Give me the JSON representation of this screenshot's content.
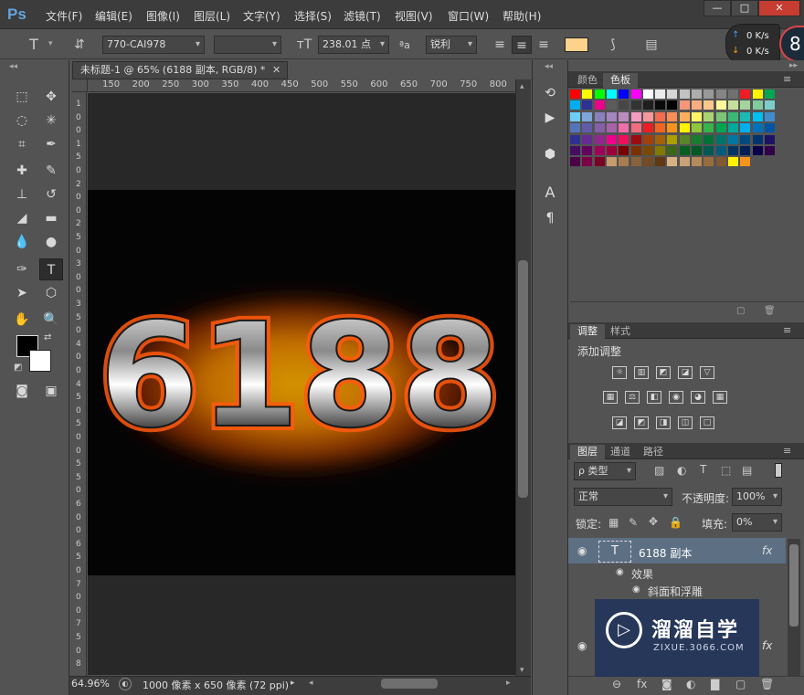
{
  "app": {
    "logo": "Ps"
  },
  "menu": [
    "文件(F)",
    "编辑(E)",
    "图像(I)",
    "图层(L)",
    "文字(Y)",
    "选择(S)",
    "滤镜(T)",
    "视图(V)",
    "窗口(W)",
    "帮助(H)"
  ],
  "window_buttons": {
    "minimize": "—",
    "restore": "□",
    "close": "✕"
  },
  "options": {
    "font_family": "770-CAI978",
    "font_style": "",
    "font_size": "238.01 点",
    "aa_label": "ªa",
    "antialias": "锐利",
    "swatch_color": "#fcd28c"
  },
  "network": {
    "up": "0 K/s",
    "down": "0 K/s",
    "number": "8"
  },
  "document": {
    "tab_title": "未标题-1 @ 65% (6188 副本, RGB/8) *",
    "zoom": "64.96%",
    "doc_info": "1000 像素 x 650 像素 (72 ppi)",
    "text_content": "6188"
  },
  "ruler": {
    "h_labels": [
      "150",
      "200",
      "250",
      "300",
      "350",
      "400",
      "450",
      "500",
      "550",
      "600",
      "650",
      "700",
      "750",
      "800"
    ],
    "v_labels": [
      "1",
      "0",
      "0",
      "1",
      "5",
      "0",
      "2",
      "0",
      "0",
      "2",
      "5",
      "0",
      "3",
      "0",
      "0",
      "3",
      "5",
      "0",
      "4",
      "0",
      "0",
      "4",
      "5",
      "0",
      "5",
      "0",
      "0",
      "5",
      "5",
      "0",
      "6",
      "0",
      "0",
      "6",
      "5",
      "0",
      "7",
      "0",
      "0",
      "7",
      "5",
      "0",
      "8"
    ]
  },
  "swatches_panel": {
    "tabs": [
      "颜色",
      "色板"
    ],
    "active": "色板",
    "colors": [
      "#ff0000",
      "#ffff00",
      "#00ff00",
      "#00ffff",
      "#0000ff",
      "#ff00ff",
      "#ffffff",
      "#ebebeb",
      "#d6d6d6",
      "#c2c2c2",
      "#adadad",
      "#999999",
      "#858585",
      "#707070",
      "#ee1d24",
      "#fff200",
      "#00a651",
      "#00aeef",
      "#2e3192",
      "#ec008c",
      "#5c5c5c",
      "#474747",
      "#333333",
      "#1f1f1f",
      "#0a0a0a",
      "#000000",
      "#f7977a",
      "#fbad82",
      "#fdc68c",
      "#fff799",
      "#c6df9c",
      "#a4d49d",
      "#81ca9d",
      "#7bcdc8",
      "#6ccff7",
      "#7da7d9",
      "#8781bd",
      "#a286bd",
      "#bc8cbf",
      "#f49bc1",
      "#f5989d",
      "#f26c4f",
      "#f68e56",
      "#fbaf5d",
      "#fff467",
      "#acd372",
      "#7cc576",
      "#3bb878",
      "#1abbb4",
      "#00bff3",
      "#438ccb",
      "#5574b9",
      "#605ca8",
      "#855fa8",
      "#a763a9",
      "#ef6ea8",
      "#f16d7e",
      "#ee1d24",
      "#f16522",
      "#f7941d",
      "#fff200",
      "#8fc63d",
      "#37b44a",
      "#00a650",
      "#00a99e",
      "#00aeef",
      "#0072bc",
      "#0054a5",
      "#2f3192",
      "#652c91",
      "#91278f",
      "#ed008c",
      "#ee105a",
      "#9d0a0f",
      "#a1410d",
      "#a36209",
      "#aba000",
      "#588528",
      "#197b30",
      "#007236",
      "#00736a",
      "#0076a4",
      "#004a80",
      "#003370",
      "#1d1363",
      "#450e61",
      "#62055f",
      "#9e005c",
      "#9d0039",
      "#790000",
      "#7b3000",
      "#7c4900",
      "#827a00",
      "#3e6617",
      "#045f20",
      "#005824",
      "#005951",
      "#005b7e",
      "#003562",
      "#002056",
      "#0c004b",
      "#30004a",
      "#4b0048",
      "#7a0045",
      "#7a0026",
      "#c69c6d",
      "#a77c50",
      "#8a6239",
      "#744b24",
      "#603813",
      "#d8b282",
      "#c9a275",
      "#b58b5c",
      "#996c3e",
      "#825832",
      "#fff200",
      "#f7941d"
    ]
  },
  "adjust_panel": {
    "tabs": [
      "调整",
      "样式"
    ],
    "title": "添加调整",
    "row1": [
      "☼",
      "▥",
      "◩",
      "◪",
      "▽"
    ],
    "row2": [
      "▦",
      "⚖",
      "◧",
      "◉",
      "◕",
      "▦"
    ],
    "row3": [
      "◪",
      "◩",
      "◨",
      "◫",
      "□"
    ]
  },
  "layers_panel": {
    "tabs": [
      "图层",
      "通道",
      "路径"
    ],
    "filter_label": "ρ 类型",
    "blend_mode": "正常",
    "opacity_label": "不透明度:",
    "opacity": "100%",
    "lock_label": "锁定:",
    "fill_label": "填充:",
    "fill": "0%",
    "layer_name": "6188 副本",
    "fx": "fx",
    "effects_label": "效果",
    "effect_name": "斜面和浮雕",
    "footer_icons": [
      "⊖",
      "fx",
      "◙",
      "◐",
      "▇",
      "▢",
      "🗑"
    ]
  },
  "watermark": {
    "title": "溜溜自学",
    "url": "ZIXUE.3066.COM"
  }
}
